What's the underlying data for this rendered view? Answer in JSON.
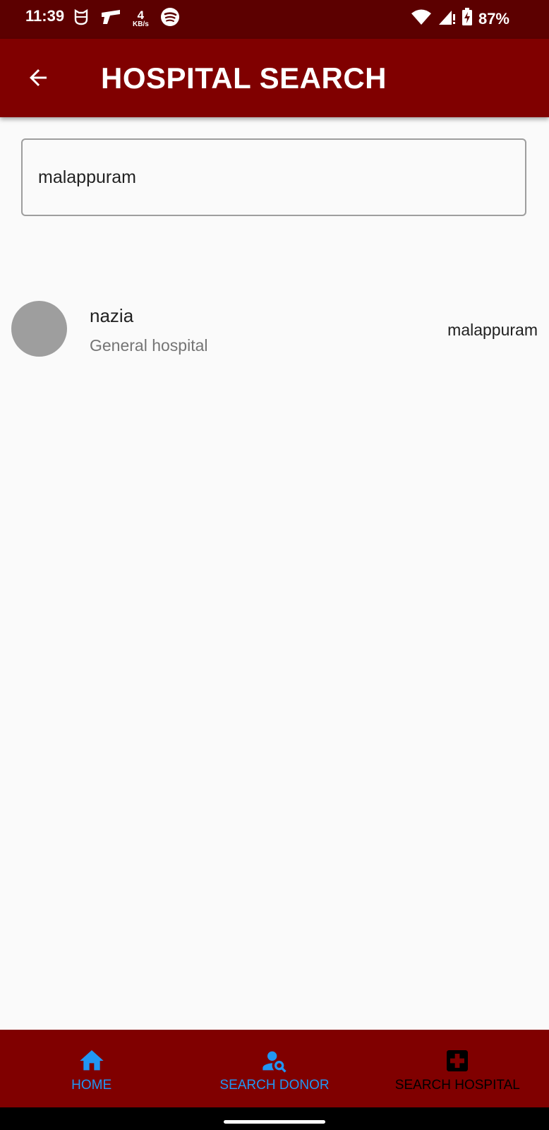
{
  "status_bar": {
    "time": "11:39",
    "network_speed_value": "4",
    "network_speed_unit": "KB/s",
    "battery": "87%",
    "icons_left": [
      "cat-face-icon",
      "gun-icon",
      "network-speed-icon",
      "spotify-icon"
    ],
    "icons_right": [
      "wifi-icon",
      "cell-signal-icon",
      "battery-charging-icon"
    ]
  },
  "app_bar": {
    "title": "HOSPITAL SEARCH",
    "back_icon": "arrow-back-icon"
  },
  "search": {
    "value": "malappuram"
  },
  "results": [
    {
      "title": "nazia",
      "subtitle": "General hospital",
      "trailing": "malappuram"
    }
  ],
  "bottom_nav": {
    "items": [
      {
        "label": "HOME",
        "icon": "home-icon"
      },
      {
        "label": "SEARCH DONOR",
        "icon": "person-search-icon"
      },
      {
        "label": "SEARCH HOSPITAL",
        "icon": "hospital-icon"
      }
    ]
  },
  "colors": {
    "status_bar": "#5c0000",
    "app_bar": "#800000",
    "bottom_nav": "#800000",
    "nav_active": "#2196f3",
    "nav_inactive": "#000000",
    "background": "#fafafa",
    "avatar": "#9e9e9e"
  }
}
